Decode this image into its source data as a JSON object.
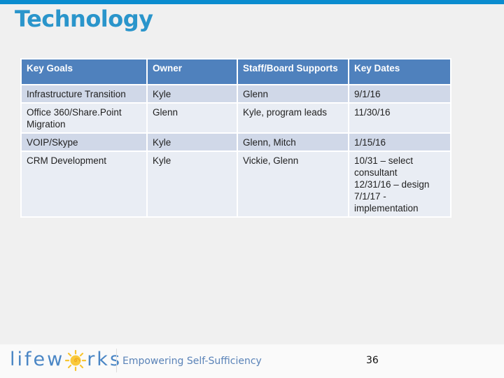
{
  "slide": {
    "title": "Technology",
    "page_number": "36"
  },
  "table": {
    "headers": [
      "Key Goals",
      "Owner",
      "Staff/Board Supports",
      "Key Dates"
    ],
    "rows": [
      {
        "goal": "Infrastructure Transition",
        "owner": "Kyle",
        "supports": "Glenn",
        "dates": [
          "9/1/16"
        ]
      },
      {
        "goal": "Office 360/Share.Point Migration",
        "owner": "Glenn",
        "supports": "Kyle, program leads",
        "dates": [
          "11/30/16"
        ]
      },
      {
        "goal": "VOIP/Skype",
        "owner": "Kyle",
        "supports": "Glenn, Mitch",
        "dates": [
          "1/15/16"
        ]
      },
      {
        "goal": "CRM Development",
        "owner": "Kyle",
        "supports": "Vickie, Glenn",
        "dates": [
          "10/31 – select consultant",
          "12/31/16 – design",
          "7/1/17 - implementation"
        ]
      }
    ]
  },
  "footer": {
    "logo_left": "lifew",
    "logo_right": "rks",
    "tagline": "Empowering Self-Sufficiency"
  },
  "colors": {
    "accent": "#0a8ccf",
    "title": "#2a95cb",
    "header_bg": "#4f81bd",
    "row_odd": "#d0d8e8",
    "row_even": "#e9edf4"
  }
}
